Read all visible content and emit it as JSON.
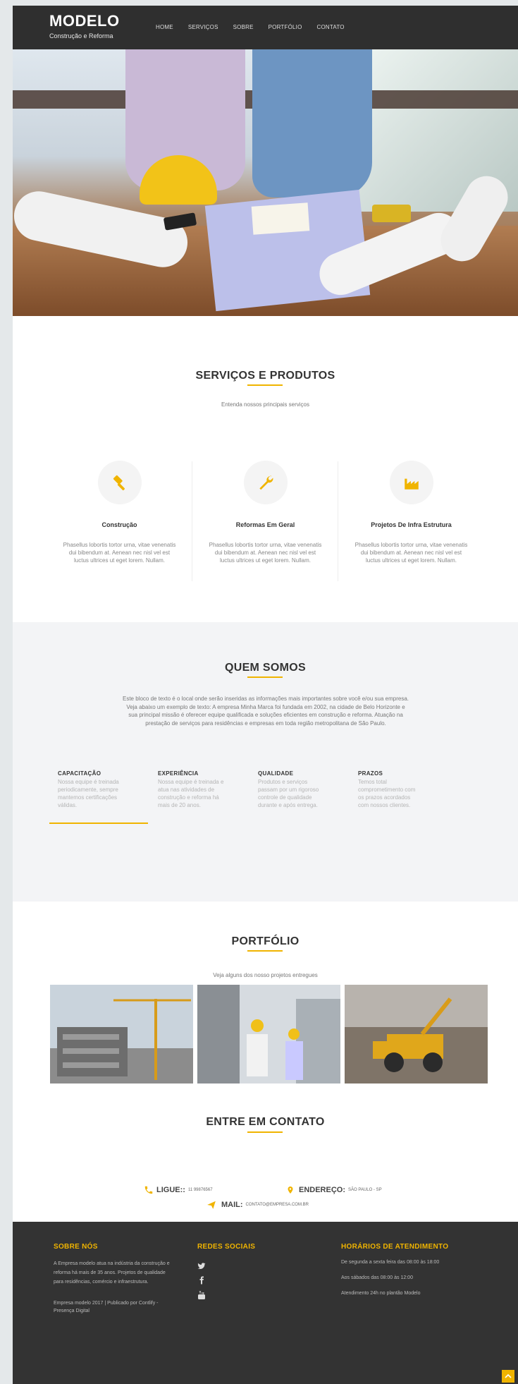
{
  "header": {
    "brand_title": "MODELO",
    "brand_subtitle": "Construção e Reforma",
    "nav": [
      "HOME",
      "SERVIÇOS",
      "SOBRE",
      "PORTFÓLIO",
      "CONTATO"
    ]
  },
  "services": {
    "title": "SERVIÇOS E PRODUTOS",
    "subtitle": "Entenda nossos principais serviços",
    "items": [
      {
        "icon": "hammer-icon",
        "title": "Construção",
        "desc": "Phasellus lobortis tortor urna, vitae venenatis dui bibendum at. Aenean nec nisl vel est luctus ultrices ut eget lorem. Nullam."
      },
      {
        "icon": "wrench-icon",
        "title": "Reformas Em Geral",
        "desc": "Phasellus lobortis tortor urna, vitae venenatis dui bibendum at. Aenean nec nisl vel est luctus ultrices ut eget lorem. Nullam."
      },
      {
        "icon": "factory-icon",
        "title": "Projetos De Infra Estrutura",
        "desc": "Phasellus lobortis tortor urna, vitae venenatis dui bibendum at. Aenean nec nisl vel est luctus ultrices ut eget lorem. Nullam."
      }
    ]
  },
  "about": {
    "title": "QUEM SOMOS",
    "text": "Este bloco de texto é o local onde serão inseridas as informações mais importantes sobre você e/ou sua empresa. Veja abaixo um exemplo de texto: A empresa Minha Marca foi fundada em 2002, na cidade de Belo Horizonte e sua principal missão é oferecer equipe qualificada e soluções eficientes em construção e reforma. Atuação na prestação de serviços para residências e empresas em toda região metropolitana de São Paulo.",
    "features": [
      {
        "title": "CAPACITAÇÃO",
        "text": "Nossa equipe é treinada periodicamente, sempre mantemos certificações válidas."
      },
      {
        "title": "EXPERIÊNCIA",
        "text": "Nossa equipe é treinada e atua nas atividades de construção e reforma há mais de 20 anos."
      },
      {
        "title": "QUALIDADE",
        "text": "Produtos e serviços passam por um rigoroso controle de qualidade durante e após entrega."
      },
      {
        "title": "PRAZOS",
        "text": "Temos total comprometimento com os prazos acordados com nossos clientes."
      }
    ]
  },
  "portfolio": {
    "title": "PORTFÓLIO",
    "subtitle": "Veja alguns dos nosso projetos entregues"
  },
  "contact": {
    "title": "ENTRE EM CONTATO",
    "phone_label": "LIGUE::",
    "phone_value": "11 99876567",
    "address_label": "ENDEREÇO:",
    "address_value": "SÃO PAULO - SP",
    "mail_label": "MAIL:",
    "mail_value": "CONTATO@EMPRESA.COM.BR"
  },
  "footer": {
    "about_title": "SOBRE NÓS",
    "about_text": "A Empresa modelo atua na indústria da construção e reforma há mais de 35 anos. Projetos de qualidade para residências, comércio e infraestrutura.",
    "credit": "Empresa modelo 2017 | Publicado por Contlify - Presença Digital",
    "social_title": "REDES SOCIAIS",
    "hours_title": "HORÁRIOS DE ATENDIMENTO",
    "hours": [
      "De segunda a sexta feira das 08:00 às 18:00",
      "Aos sábados das 08:00 às 12:00",
      "Atendimento 24h no plantão Modelo"
    ]
  },
  "colors": {
    "accent": "#f0b400",
    "header_bg": "#2f2f2f",
    "footer_bg": "#333333",
    "about_bg": "#f3f4f6"
  }
}
